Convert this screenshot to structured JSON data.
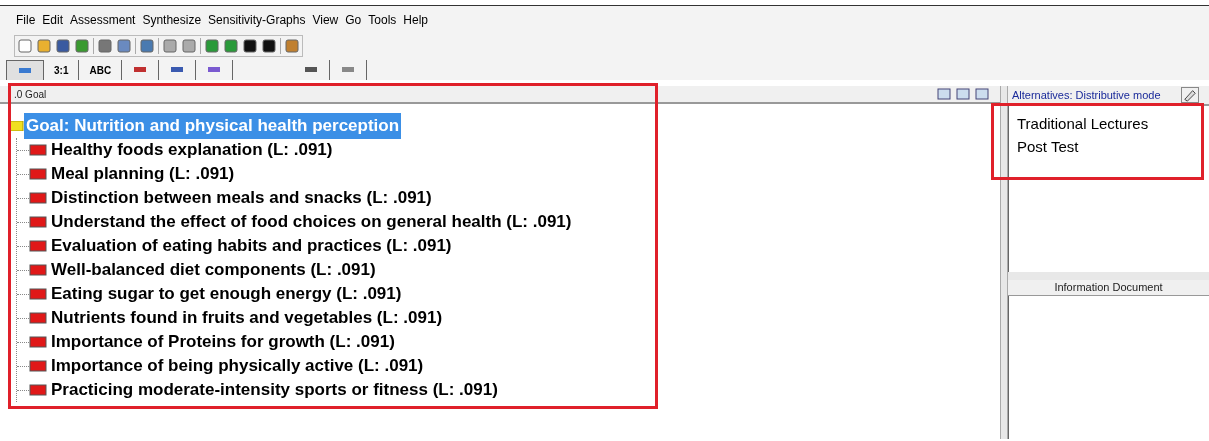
{
  "menu": [
    "File",
    "Edit",
    "Assessment",
    "Synthesize",
    "Sensitivity-Graphs",
    "View",
    "Go",
    "Tools",
    "Help"
  ],
  "view_tabs": [
    {
      "kind": "icon",
      "selected": true
    },
    {
      "kind": "text",
      "label": "3:1",
      "selected": false
    },
    {
      "kind": "text",
      "label": "ABC",
      "selected": false
    },
    {
      "kind": "icon",
      "selected": false
    },
    {
      "kind": "icon",
      "selected": false
    },
    {
      "kind": "icon",
      "selected": false
    },
    {
      "kind": "icon",
      "selected": false
    },
    {
      "kind": "icon",
      "selected": false
    }
  ],
  "tree_panel": {
    "path": ".0 Goal"
  },
  "tree": {
    "label": "Goal: Nutrition and physical health perception",
    "selected": true,
    "children": [
      {
        "label": "Healthy foods explanation (L: .091)"
      },
      {
        "label": "Meal planning (L: .091)"
      },
      {
        "label": "Distinction between meals and snacks (L: .091)"
      },
      {
        "label": "Understand the effect of food choices on general health (L: .091)"
      },
      {
        "label": "Evaluation of eating habits and practices (L: .091)"
      },
      {
        "label": "Well-balanced diet components (L: .091)"
      },
      {
        "label": "Eating sugar to get enough energy (L: .091)"
      },
      {
        "label": "Nutrients found in fruits and vegetables (L: .091)"
      },
      {
        "label": "Importance of Proteins for growth (L: .091)"
      },
      {
        "label": "Importance of being physically active (L: .091)"
      },
      {
        "label": "Practicing moderate-intensity sports or fitness (L: .091)"
      }
    ]
  },
  "alternatives": {
    "header": "Alternatives: Distributive mode",
    "items": [
      "Traditional Lectures",
      "Post Test"
    ]
  },
  "information_document": {
    "header": "Information Document"
  }
}
